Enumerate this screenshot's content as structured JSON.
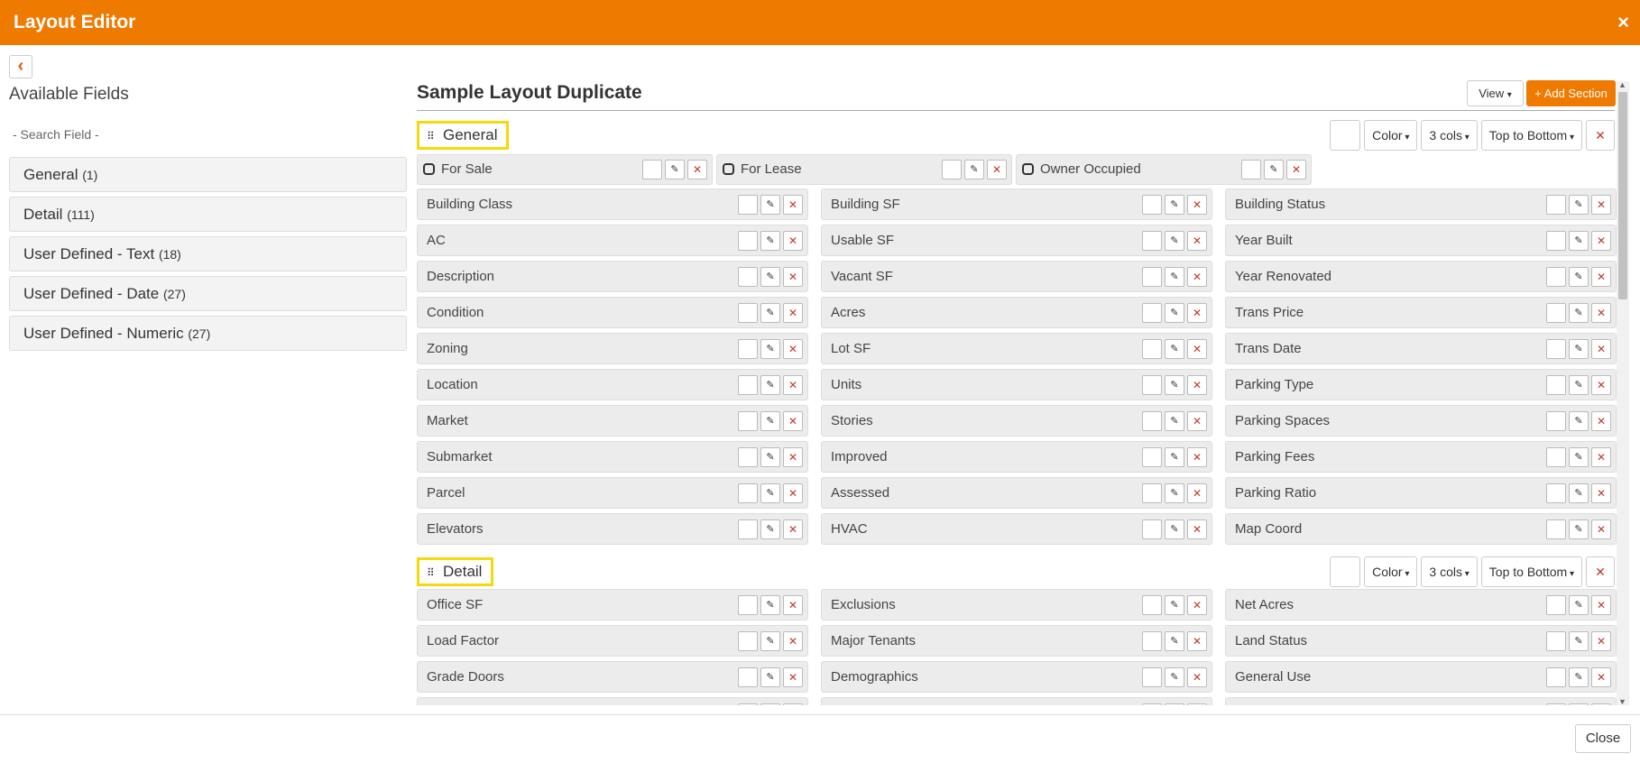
{
  "header": {
    "title": "Layout Editor",
    "close_glyph": "×"
  },
  "sidebar": {
    "title": "Available Fields",
    "search_placeholder": "- Search Field -",
    "categories": [
      {
        "label": "General",
        "count": "(1)"
      },
      {
        "label": "Detail",
        "count": "(111)"
      },
      {
        "label": "User Defined - Text",
        "count": "(18)"
      },
      {
        "label": "User Defined - Date",
        "count": "(27)"
      },
      {
        "label": "User Defined - Numeric",
        "count": "(27)"
      }
    ]
  },
  "layout": {
    "title": "Sample Layout Duplicate",
    "view_label": "View",
    "add_section_label": "+ Add Section",
    "sections": [
      {
        "name": "General",
        "color_label": "Color",
        "cols_label": "3 cols",
        "order_label": "Top to Bottom",
        "checkboxes": [
          "For Sale",
          "For Lease",
          "Owner Occupied"
        ],
        "fields": [
          "Building Class",
          "Building SF",
          "Building Status",
          "AC",
          "Usable SF",
          "Year Built",
          "Description",
          "Vacant SF",
          "Year Renovated",
          "Condition",
          "Acres",
          "Trans Price",
          "Zoning",
          "Lot SF",
          "Trans Date",
          "Location",
          "Units",
          "Parking Type",
          "Market",
          "Stories",
          "Parking Spaces",
          "Submarket",
          "Improved",
          "Parking Fees",
          "Parcel",
          "Assessed",
          "Parking Ratio",
          "Elevators",
          "HVAC",
          "Map Coord"
        ]
      },
      {
        "name": "Detail",
        "color_label": "Color",
        "cols_label": "3 cols",
        "order_label": "Top to Bottom",
        "checkboxes": [],
        "fields": [
          "Office SF",
          "Exclusions",
          "Net Acres",
          "Load Factor",
          "Major Tenants",
          "Land Status",
          "Grade Doors",
          "Demographics",
          "General Use",
          "",
          "",
          ""
        ]
      }
    ]
  },
  "footer": {
    "close_label": "Close"
  },
  "icons": {
    "edit": "edit-icon",
    "delete": "delete-icon",
    "drag": "drag-handle-icon",
    "back": "chevron-left-icon"
  },
  "colors": {
    "accent": "#ef7a00",
    "highlight": "#f5d90a",
    "danger": "#c0392b"
  }
}
